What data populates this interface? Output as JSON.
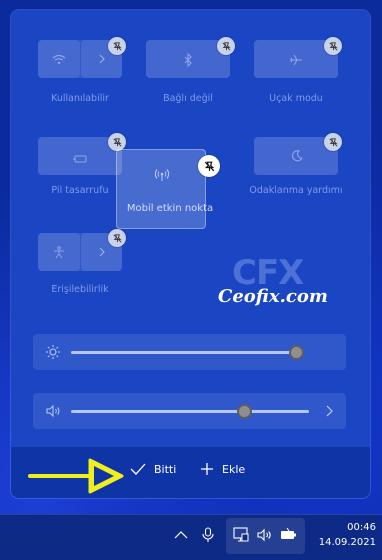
{
  "tiles": {
    "wifi": {
      "label": "Kullanılabilir",
      "icon": "wifi-icon",
      "chevron": "chevron-right-icon"
    },
    "bluetooth": {
      "label": "Bağlı değil",
      "icon": "bluetooth-icon"
    },
    "airplane": {
      "label": "Uçak modu",
      "icon": "airplane-icon"
    },
    "battery_saver": {
      "label": "Pil tasarrufu",
      "icon": "battery-saver-icon"
    },
    "focus": {
      "label": "Odaklanma yardımı",
      "icon": "moon-icon"
    },
    "accessibility": {
      "label": "Erişilebilirlik",
      "icon": "accessibility-icon",
      "chevron": "chevron-right-icon"
    }
  },
  "dragging_tile": {
    "label": "Mobil etkin nokta",
    "icon": "mobile-hotspot-icon"
  },
  "watermark": {
    "logo": "CFX",
    "text": "Ceofix.com"
  },
  "sliders": {
    "brightness": {
      "icon": "brightness-icon",
      "value": 0.98
    },
    "volume": {
      "icon": "speaker-icon",
      "value": 0.73,
      "chevron": "chevron-right-icon"
    }
  },
  "footer": {
    "done_label": "Bitti",
    "add_label": "Ekle"
  },
  "taskbar": {
    "time": "00:46",
    "date": "14.09.2021",
    "icons": [
      "chevron-up-icon",
      "microphone-icon",
      "network-icon",
      "volume-icon",
      "battery-icon"
    ]
  },
  "colors": {
    "panel": "#1a46c4",
    "footer": "#0f34a5",
    "taskbar": "#0d2a86",
    "arrow": "#f0ee1c"
  }
}
